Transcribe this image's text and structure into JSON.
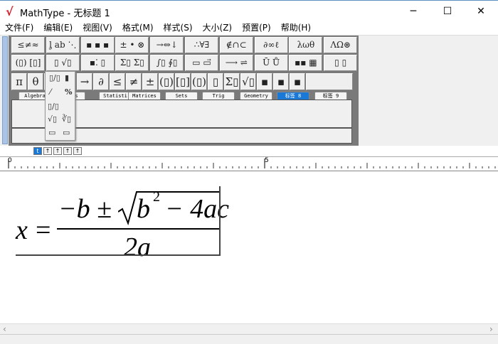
{
  "window": {
    "title": "MathType - 无标题 1",
    "minimize": "─",
    "maximize": "☐",
    "close": "✕"
  },
  "menu": [
    "文件(F)",
    "编辑(E)",
    "视图(V)",
    "格式(M)",
    "样式(S)",
    "大小(Z)",
    "预置(P)",
    "帮助(H)"
  ],
  "palette_row1": [
    "≤≠≈",
    "ᶅ ab ⋱",
    "▪ ▪ ▪",
    "± • ⊗",
    "→⇔↓",
    "∴∀∃",
    "∉∩⊂",
    "∂∞ℓ",
    "λωθ",
    "ΛΩ⊛"
  ],
  "palette_row2": [
    "(▯) [▯]",
    "▯ √▯",
    "▪⁚ ▯",
    "Σ▯ Σ▯",
    "∫▯ ∮▯",
    "▭ ▭⃗",
    "⟶ ⇌",
    "Ū Ů",
    "▪▪ ▦",
    "▯ ▯"
  ],
  "palette_row3": [
    "π",
    "θ",
    "",
    "",
    "→",
    "∂",
    "≤",
    "≠",
    "±",
    "(▯)",
    "[▯]",
    "(▯)",
    "▯",
    "Σ▯",
    "√▯",
    "▪",
    "▪",
    "▪"
  ],
  "tabs": [
    "Algebra",
    "Derivs",
    "Statisti",
    "Matrices",
    "Sets",
    "Trig",
    "Geometry",
    "标签 8",
    "标签 9"
  ],
  "active_tab": "标签 8",
  "fraction_popup": [
    "▯/▯",
    "▮",
    "⁄",
    "%",
    "▯/▯",
    "",
    "√▯",
    "∛▯",
    "▭",
    "▭"
  ],
  "size_buttons": [
    "t",
    "↑",
    "↑",
    "↑",
    "↑"
  ],
  "ruler": {
    "mark0": "0",
    "mark5": "5"
  },
  "formula": {
    "lhs": "x",
    "equals": "=",
    "numerator_a": "−b ±",
    "radicand": "b",
    "exponent": "2",
    "radicand_rest": "− 4ac",
    "denominator": "2a"
  },
  "scroll": {
    "left": "‹",
    "right": "›"
  }
}
